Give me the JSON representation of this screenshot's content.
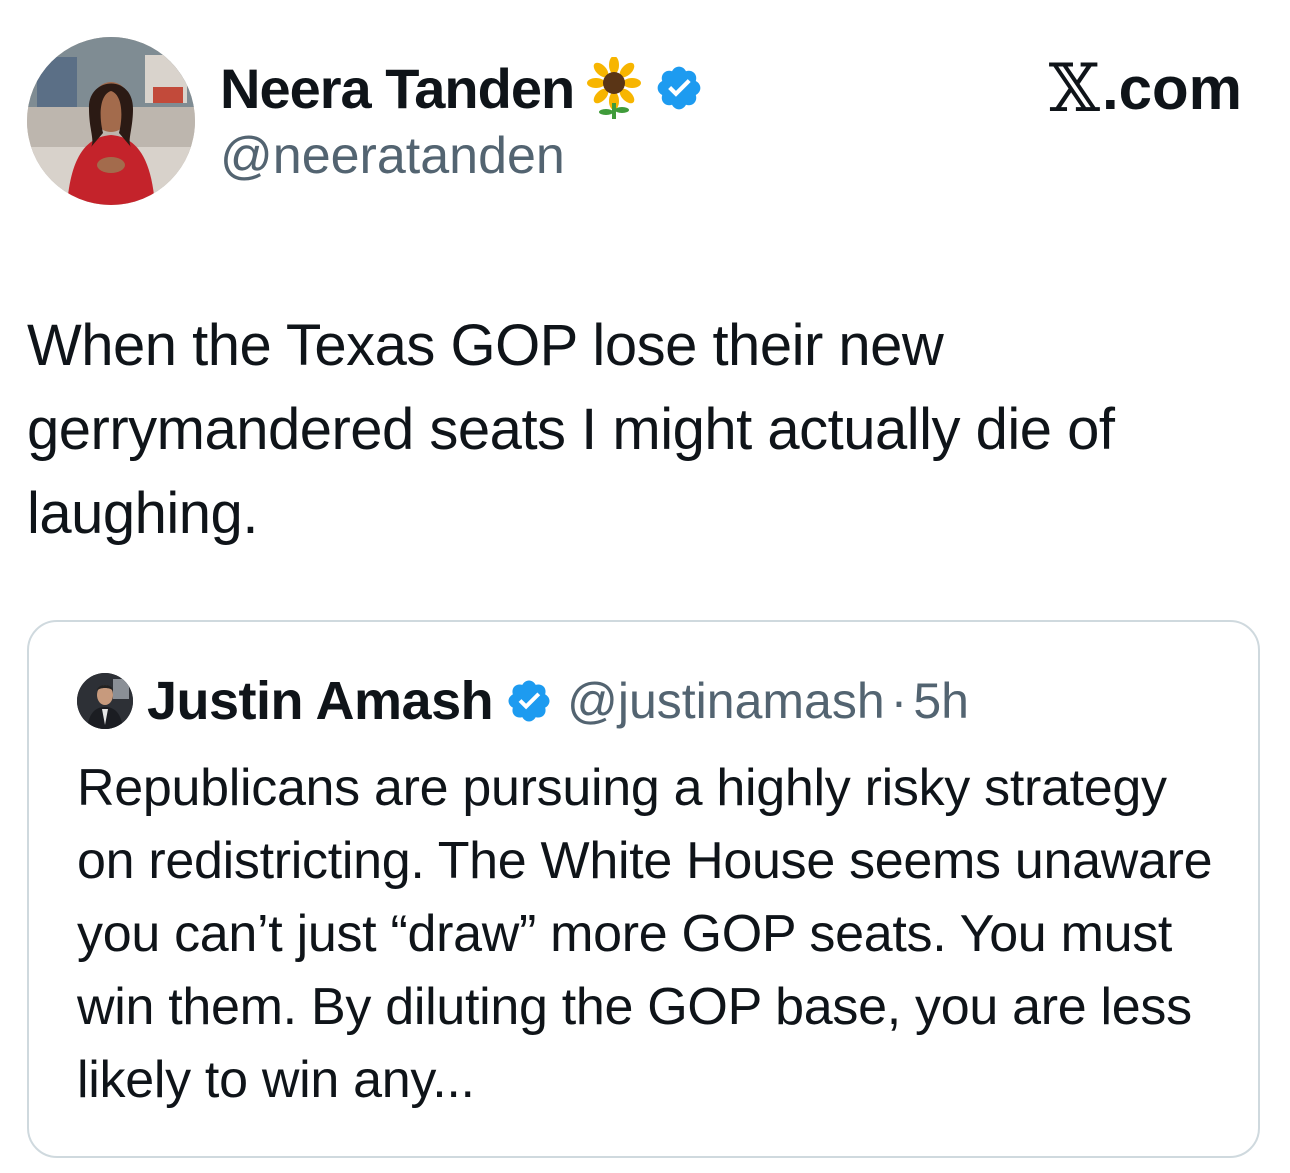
{
  "post": {
    "author": {
      "name": "Neera Tanden",
      "emoji_icon": "sunflower-icon",
      "verified_icon": "verified-badge-icon",
      "handle": "@neeratanden"
    },
    "site": {
      "logo_letter": "𝕏",
      "label": ".com"
    },
    "text": "When the Texas GOP lose their new gerrymandered seats I might actually die of laughing."
  },
  "quoted_post": {
    "author": {
      "name": "Justin Amash",
      "verified_icon": "verified-badge-icon",
      "handle": "@justinamash"
    },
    "separator": "·",
    "time": "5h",
    "text": "Republicans are pursuing a highly risky strategy on redistricting. The White House seems unaware you can’t just “draw” more GOP seats. You must win them. By diluting the GOP base, you are less likely to win any..."
  },
  "colors": {
    "text_primary": "#0f1419",
    "text_secondary": "#536471",
    "verified_blue": "#1d9bf0",
    "card_border": "#cfd9de"
  }
}
